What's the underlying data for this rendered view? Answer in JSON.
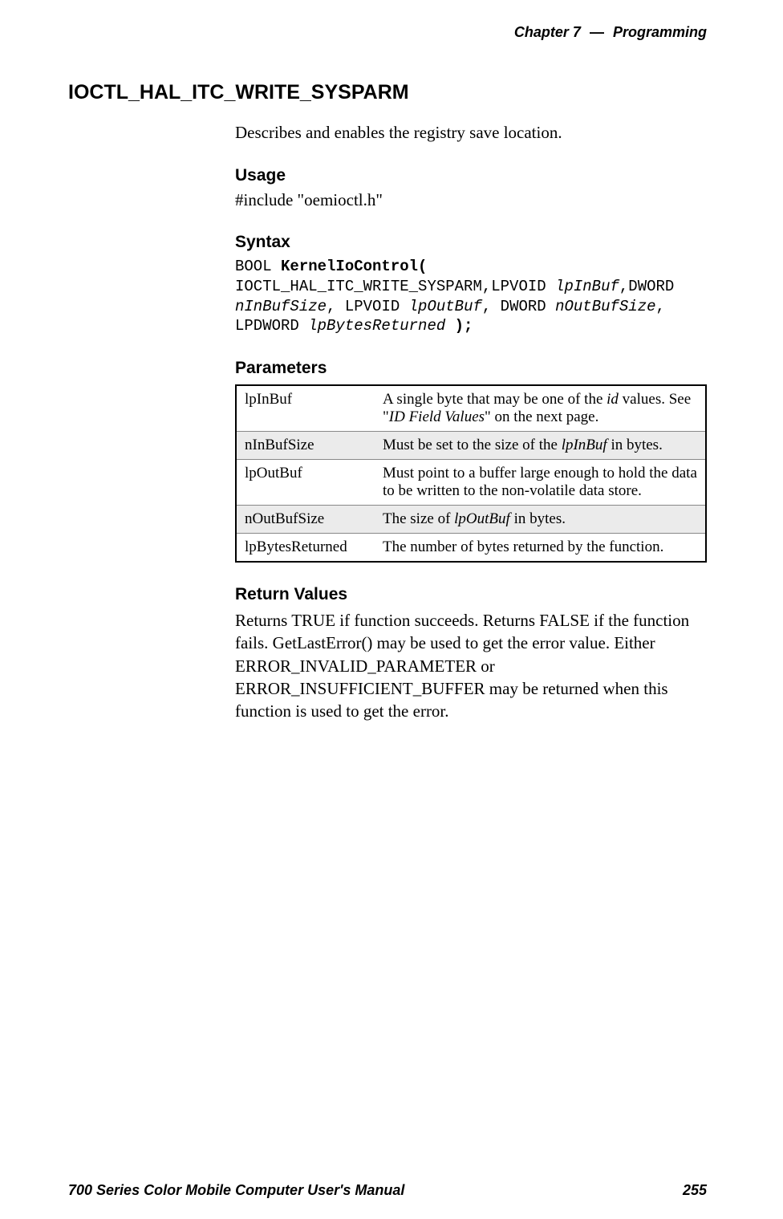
{
  "header": {
    "chapter_prefix": "Chapter",
    "chapter_num": "7",
    "separator": "—",
    "title": "Programming"
  },
  "main_heading": "IOCTL_HAL_ITC_WRITE_SYSPARM",
  "description": "Describes and enables the registry save location.",
  "usage": {
    "heading": "Usage",
    "text": "#include \"oemioctl.h\""
  },
  "syntax": {
    "heading": "Syntax",
    "tokens": {
      "t1": "BOOL ",
      "t2": "KernelIoControl(",
      "t3": " IOCTL_HAL_ITC_WRITE_SYSPARM,LPVOID ",
      "t4": "lpInBuf",
      "t5": ",DWORD ",
      "t6": "nInBufSize",
      "t7": ", LPVOID ",
      "t8": "lpOutBuf",
      "t9": ", DWORD ",
      "t10": "nOutBufSize",
      "t11": ", LPDWORD ",
      "t12": "lpBytesReturned",
      "t13": " );"
    }
  },
  "parameters": {
    "heading": "Parameters",
    "rows": [
      {
        "name": "lpInBuf",
        "desc_pre": "A single byte that may be one of the ",
        "desc_ital1": "id",
        "desc_mid": " values. See \"",
        "desc_ital2": "ID Field Values",
        "desc_post": "\" on the next page."
      },
      {
        "name": "nInBufSize",
        "desc_pre": "Must be set to the size of the ",
        "desc_ital1": "lpInBuf",
        "desc_mid": " in bytes.",
        "desc_ital2": "",
        "desc_post": ""
      },
      {
        "name": "lpOutBuf",
        "desc_pre": "Must point to a buffer large enough to hold the data to be written to the non-volatile data store.",
        "desc_ital1": "",
        "desc_mid": "",
        "desc_ital2": "",
        "desc_post": ""
      },
      {
        "name": "nOutBufSize",
        "desc_pre": "The size of ",
        "desc_ital1": "lpOutBuf",
        "desc_mid": " in bytes.",
        "desc_ital2": "",
        "desc_post": ""
      },
      {
        "name": "lpBytesReturned",
        "desc_pre": "The number of bytes returned by the function.",
        "desc_ital1": "",
        "desc_mid": "",
        "desc_ital2": "",
        "desc_post": ""
      }
    ]
  },
  "return_values": {
    "heading": "Return Values",
    "text": "Returns TRUE if function succeeds. Returns FALSE if the function fails. GetLastError() may be used to get the error value. Either ERROR_INVALID_PARAMETER or ERROR_INSUFFICIENT_BUFFER may be returned when this function is used to get the error."
  },
  "footer": {
    "left": "700 Series Color Mobile Computer User's Manual",
    "right": "255"
  }
}
